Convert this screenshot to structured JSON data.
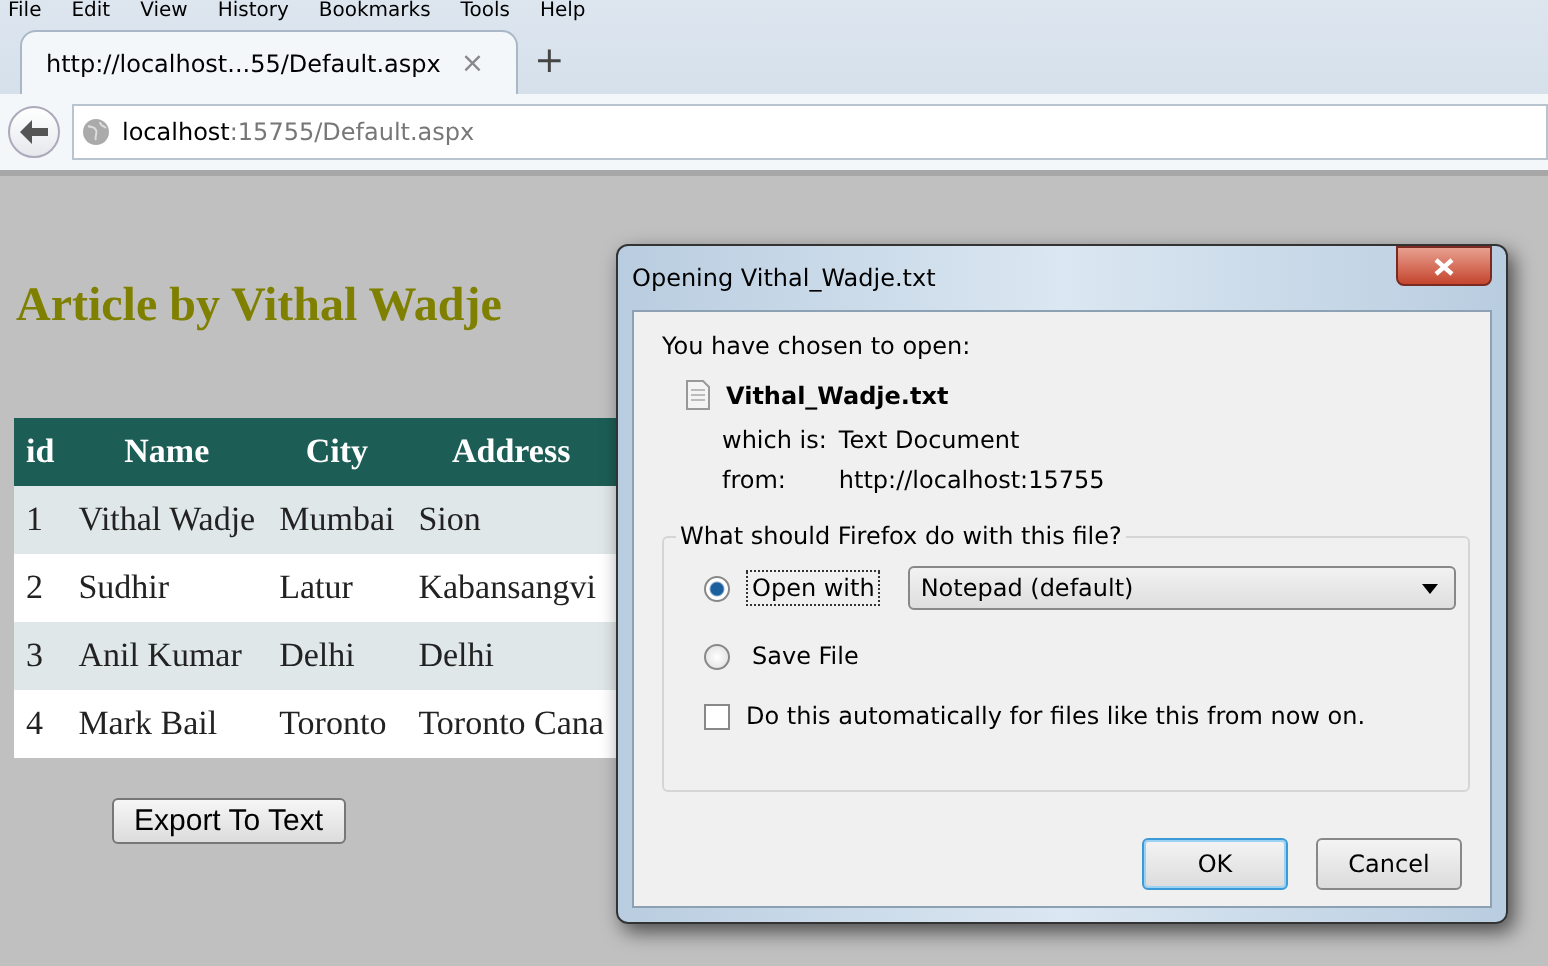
{
  "menu": [
    "File",
    "Edit",
    "View",
    "History",
    "Bookmarks",
    "Tools",
    "Help"
  ],
  "tabs": [
    {
      "label": "http://localhost...55/Default.aspx",
      "selected": true,
      "close": "×"
    }
  ],
  "new_tab": "+",
  "address": {
    "host": "localhost",
    "rest": ":15755/Default.aspx"
  },
  "page": {
    "heading": "Article by Vithal Wadje",
    "table": {
      "columns": [
        "id",
        "Name",
        "City",
        "Address"
      ],
      "rows": [
        [
          "1",
          "Vithal Wadje",
          "Mumbai",
          "Sion"
        ],
        [
          "2",
          "Sudhir",
          "Latur",
          "Kabansangvi"
        ],
        [
          "3",
          "Anil Kumar",
          "Delhi",
          "Delhi"
        ],
        [
          "4",
          "Mark Bail",
          "Toronto",
          "Toronto Cana"
        ]
      ]
    },
    "button": "Export To Text"
  },
  "dialog": {
    "title": "Opening Vithal_Wadje.txt",
    "intro": "You have chosen to open:",
    "file": "Vithal_Wadje.txt",
    "which_label": "which is:",
    "which": "Text Document",
    "from_label": "from:",
    "from": "http://localhost:15755",
    "group": "What should Firefox do with this file?",
    "options": [
      {
        "label": "Open with",
        "selected": true
      },
      {
        "label": "Save File",
        "selected": false
      }
    ],
    "app": "Notepad (default)",
    "auto": {
      "label": "Do this automatically for files like this from now on.",
      "checked": false
    },
    "buttons": [
      {
        "label": "OK",
        "default": true
      },
      {
        "label": "Cancel",
        "default": false
      }
    ]
  }
}
